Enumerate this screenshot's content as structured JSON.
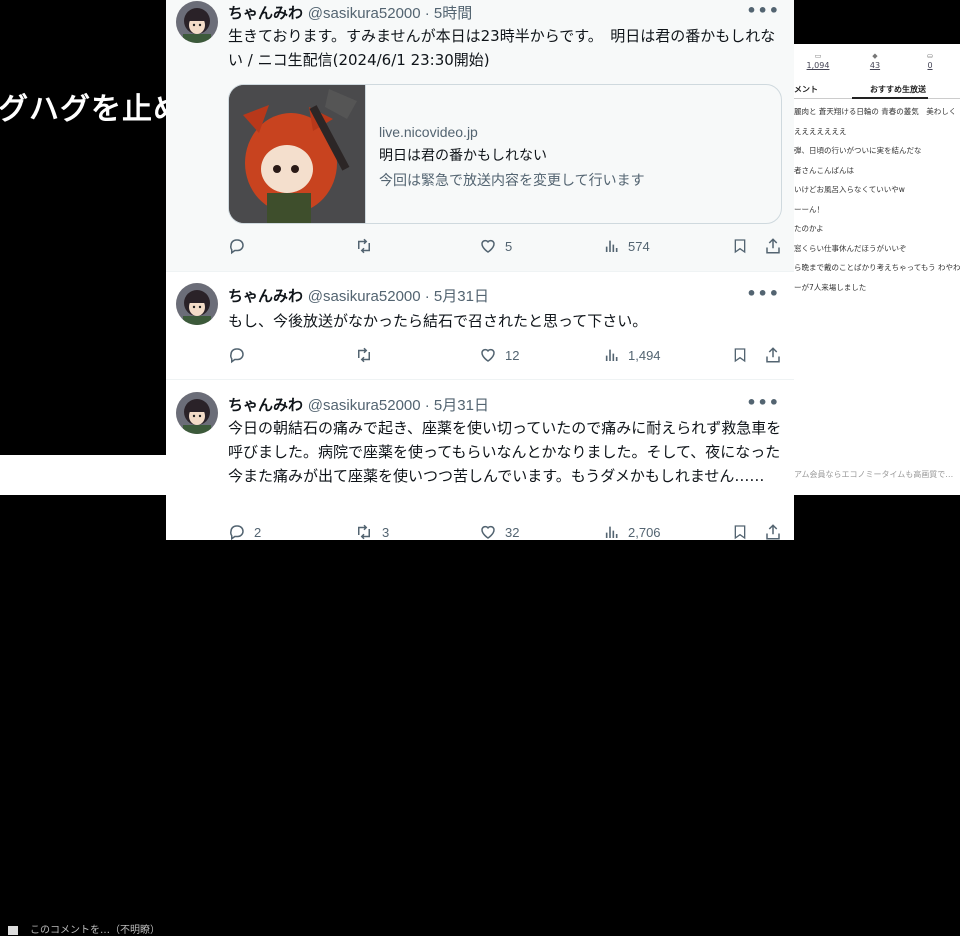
{
  "background": {
    "overlay_text": "グハグを止め",
    "left_notice": "このコメントを…（不明瞭）",
    "stats": [
      "1,094",
      "43",
      "0"
    ],
    "tabs": [
      "メント",
      "おすすめ生放送"
    ],
    "comments": [
      "麗肉と 蒼天翔ける日輪の 青春の叢気　美わしく",
      "えええええええ",
      "弾、日頃の行いがついに実を結んだな",
      "者さんこんばんは",
      "いけどお風呂入らなくていいやw",
      "ーーん！",
      "たのかよ",
      "窓くらい仕事休んだほうがいいぞ",
      "ら晩まで戴のことばかり考えちゃってもう わやわ",
      "ーが7人来場しました"
    ],
    "footer": "アム会員ならエコノミータイムも高画質で…"
  },
  "tweets": [
    {
      "name": "ちゃんみわ",
      "handle": "@sasikura52000 · 5時間",
      "text": "生きております。すみませんが本日は23時半からです。　明日は君の番かもしれない / ニコ生配信(2024/6/1 23:30開始)",
      "card": {
        "domain": "live.nicovideo.jp",
        "title": "明日は君の番かもしれない",
        "description": "今回は緊急で放送内容を変更して行います"
      },
      "replies": "",
      "retweets": "",
      "likes": "5",
      "views": "574"
    },
    {
      "name": "ちゃんみわ",
      "handle": "@sasikura52000 · 5月31日",
      "text": "もし、今後放送がなかったら結石で召されたと思って下さい。",
      "replies": "",
      "retweets": "",
      "likes": "12",
      "views": "1,494"
    },
    {
      "name": "ちゃんみわ",
      "handle": "@sasikura52000 · 5月31日",
      "text": "今日の朝結石の痛みで起き、座薬を使い切っていたので痛みに耐えられず救急車を呼びました。病院で座薬を使ってもらいなんとかなりました。そして、夜になった今また痛みが出て座薬を使いつつ苦しんでいます。もうダメかもしれません……",
      "replies": "2",
      "retweets": "3",
      "likes": "32",
      "views": "2,706"
    }
  ],
  "more_glyph": "•••",
  "colors": {
    "text": "#0f1419",
    "secondary": "#536471",
    "border": "#cfd9de"
  }
}
